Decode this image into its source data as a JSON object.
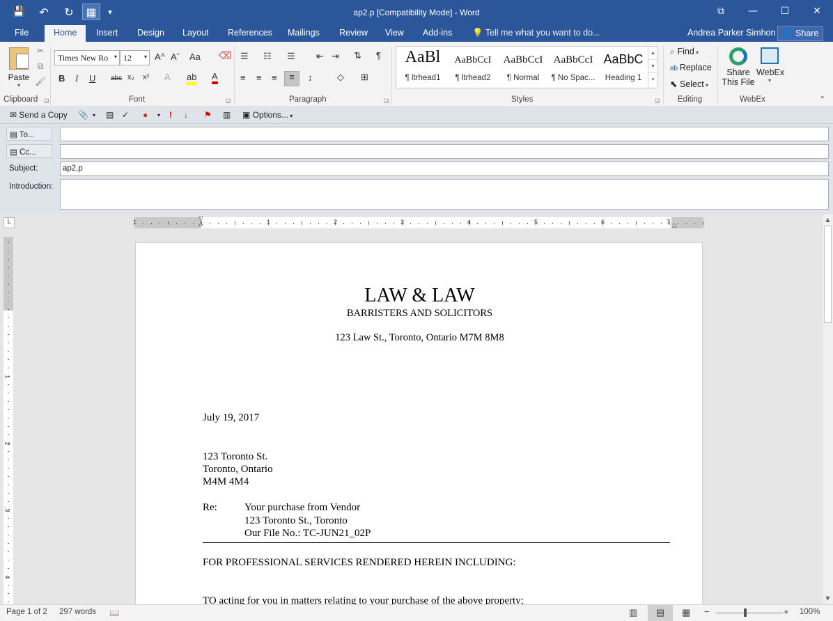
{
  "window": {
    "title": "ap2.p [Compatibility Mode] - Word",
    "controls": {
      "restore": "⧉",
      "minimize": "—",
      "maximize": "☐",
      "close": "✕"
    }
  },
  "qat": {
    "save": "💾",
    "undo": "↶",
    "redo": "↻",
    "touch": "▦",
    "customize": "▾"
  },
  "tabs": [
    "File",
    "Home",
    "Insert",
    "Design",
    "Layout",
    "References",
    "Mailings",
    "Review",
    "View",
    "Add-ins"
  ],
  "active_tab": "Home",
  "tell_me": "Tell me what you want to do...",
  "user": "Andrea Parker Simhon",
  "share": "Share",
  "ribbon": {
    "clipboard": {
      "label": "Clipboard",
      "paste": "Paste"
    },
    "font": {
      "label": "Font",
      "font_name": "Times New Ro",
      "font_size": "12",
      "bold": "B",
      "italic": "I",
      "underline": "U",
      "strike": "abc",
      "sub": "x₂",
      "sup": "x²",
      "grow": "A^",
      "shrink": "Aˇ",
      "case": "Aa",
      "text_effects": "A",
      "highlight": "ab",
      "font_color": "A"
    },
    "paragraph": {
      "label": "Paragraph",
      "pilcrow": "¶"
    },
    "styles": {
      "label": "Styles",
      "items": [
        {
          "sample": "AaBl",
          "name": "¶ ltrhead1"
        },
        {
          "sample": "AaBbCcI",
          "name": "¶ ltrhead2"
        },
        {
          "sample": "AaBbCcI",
          "name": "¶ Normal"
        },
        {
          "sample": "AaBbCcI",
          "name": "¶ No Spac..."
        },
        {
          "sample": "AaBbC",
          "name": "Heading 1"
        }
      ]
    },
    "editing": {
      "label": "Editing",
      "find": "Find",
      "replace": "Replace",
      "select": "Select"
    },
    "webex": {
      "label": "WebEx",
      "share_line1": "Share",
      "share_line2": "This File",
      "webex": "WebEx"
    }
  },
  "mailbar": {
    "send_copy": "Send a Copy",
    "options": "Options..."
  },
  "envelope": {
    "to_label": "To...",
    "cc_label": "Cc...",
    "subject_label": "Subject:",
    "subject_value": "ap2.p",
    "intro_label": "Introduction:"
  },
  "ruler": {
    "numbers": [
      "1",
      "1",
      "2",
      "3",
      "4",
      "5",
      "6",
      "7"
    ],
    "corner": "L",
    "vnumbers": [
      "1",
      "1",
      "2",
      "3",
      "4"
    ]
  },
  "document": {
    "firm": "LAW & LAW",
    "subtitle": "BARRISTERS AND SOLICITORS",
    "address": "123 Law St., Toronto, Ontario  M7M 8M8",
    "date": "July 19, 2017",
    "recipient": [
      "123 Toronto St.",
      "Toronto, Ontario",
      "M4M 4M4"
    ],
    "re_label": "Re:",
    "re_lines": [
      "Your purchase from Vendor",
      "123 Toronto St., Toronto",
      "Our File No.: TC-JUN21_02P"
    ],
    "services_heading": "FOR PROFESSIONAL SERVICES RENDERED HEREIN INCLUDING:",
    "body_start": "TO acting for you in matters relating to your purchase of the above property;"
  },
  "status": {
    "page": "Page 1 of 2",
    "words": "297 words",
    "zoom": "100%",
    "zoom_level_percent": 100
  },
  "colors": {
    "accent": "#2b579a"
  }
}
